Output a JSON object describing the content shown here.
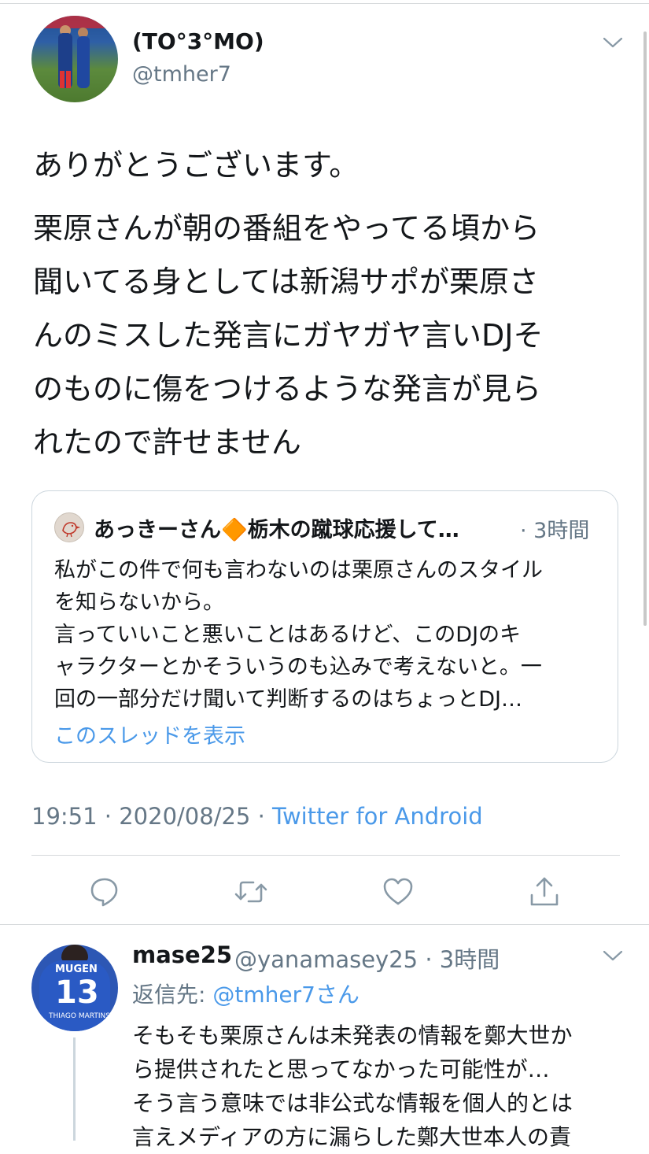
{
  "tweet": {
    "author_name": "(TO°3°MO)",
    "author_handle": "@tmher7",
    "body_paragraph_1": "ありがとうございます。",
    "body_lines": [
      "栗原さんが朝の番組をやってる頃から",
      "聞いてる身としては新潟サポが栗原さ",
      "んのミスした発言にガヤガヤ言いDJそ",
      "のものに傷をつけるような発言が見ら",
      "れたので許せません"
    ],
    "quoted": {
      "author_name": "あっきーさん🔶栃木の蹴球応援して…",
      "time": "· 3時間",
      "text_lines": [
        "私がこの件で何も言わないのは栗原さんのスタイル",
        "を知らないから。",
        "言っていいこと悪いことはあるけど、このDJのキ",
        "ャラクターとかそういうのも込みで考えないと。一",
        "回の一部分だけ聞いて判断するのはちょっとDJ…"
      ],
      "show_thread": "このスレッドを表示"
    },
    "meta_time": "19:51 · 2020/08/25 · ",
    "meta_source": "Twitter for Android",
    "actions": [
      "reply-icon",
      "retweet-icon",
      "like-icon",
      "share-icon"
    ]
  },
  "reply": {
    "author_name": "mase25",
    "author_handle": "@yanamasey25 · 3時間",
    "reply_to_label": "返信先: ",
    "reply_to_mention": "@tmher7さん",
    "text_lines": [
      "そもそも栗原さんは未発表の情報を鄭大世か",
      "ら提供されたと思ってなかった可能性が…",
      "そう言う意味では非公式な情報を個人的とは",
      "言えメディアの方に漏らした鄭大世本人の責"
    ],
    "avatar_jersey_number": "13",
    "avatar_jersey_brand": "MUGEN",
    "avatar_jersey_name": "THIAGO MARTINS"
  },
  "colors": {
    "link": "#4a99e9",
    "secondary_text": "#657786",
    "border": "#ccd6dd"
  }
}
